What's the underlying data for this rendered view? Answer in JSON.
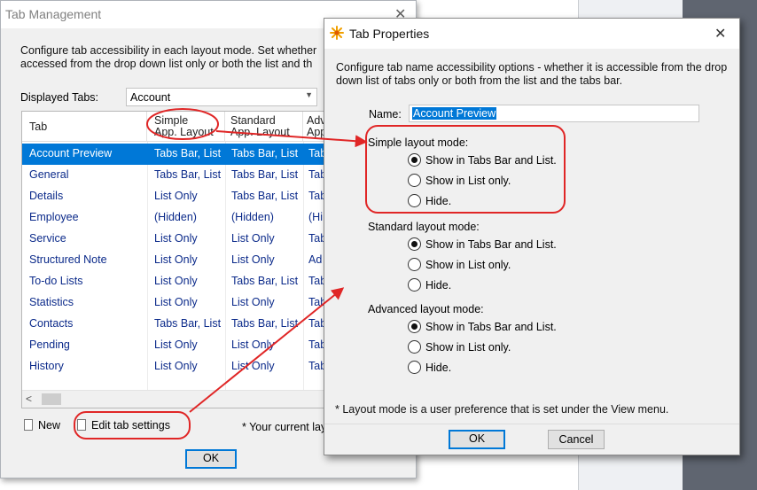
{
  "tab_management": {
    "title": "Tab Management",
    "description_line1": "Configure tab accessibility in each layout mode. Set whether",
    "description_line2": "accessed from the drop down list only or both the list and th",
    "displayed_tabs_label": "Displayed Tabs:",
    "displayed_tabs_value": "Account",
    "columns": [
      {
        "line1": "Tab",
        "line2": ""
      },
      {
        "line1": "Simple",
        "line2": "App. Layout"
      },
      {
        "line1": "Standard",
        "line2": "App. Layout"
      },
      {
        "line1": "Adv",
        "line2": "App"
      }
    ],
    "rows": [
      {
        "name": "Account Preview",
        "simple": "Tabs Bar, List",
        "standard": "Tabs Bar, List",
        "adv": "Tab"
      },
      {
        "name": "General",
        "simple": "Tabs Bar, List",
        "standard": "Tabs Bar, List",
        "adv": "Tab"
      },
      {
        "name": "Details",
        "simple": "List Only",
        "standard": "Tabs Bar, List",
        "adv": "Tab"
      },
      {
        "name": "Employee",
        "simple": "(Hidden)",
        "standard": "(Hidden)",
        "adv": "(Hi"
      },
      {
        "name": "Service",
        "simple": "List Only",
        "standard": "List Only",
        "adv": "Tab"
      },
      {
        "name": "Structured Note",
        "simple": "List Only",
        "standard": "List Only",
        "adv": "Ad"
      },
      {
        "name": "To-do Lists",
        "simple": "List Only",
        "standard": "Tabs Bar, List",
        "adv": "Tab"
      },
      {
        "name": "Statistics",
        "simple": "List Only",
        "standard": "List Only",
        "adv": "Tab"
      },
      {
        "name": "Contacts",
        "simple": "Tabs Bar, List",
        "standard": "Tabs Bar, List",
        "adv": "Tab"
      },
      {
        "name": "Pending",
        "simple": "List Only",
        "standard": "List Only",
        "adv": "Tab"
      },
      {
        "name": "History",
        "simple": "List Only",
        "standard": "List Only",
        "adv": "Tab"
      }
    ],
    "new_label": "New",
    "edit_label": "Edit tab settings",
    "current_note": "* Your current lay",
    "ok_label": "OK"
  },
  "tab_properties": {
    "title": "Tab Properties",
    "description": "Configure tab name accessibility options - whether it is accessible from the drop down list of tabs only or both from the list and the tabs bar.",
    "name_label": "Name:",
    "name_value": "Account Preview",
    "groups": [
      {
        "label": "Simple layout mode:",
        "options": [
          "Show in Tabs Bar and List.",
          "Show in List only.",
          "Hide."
        ],
        "selected": 0
      },
      {
        "label": "Standard layout mode:",
        "options": [
          "Show in Tabs Bar and List.",
          "Show in List only.",
          "Hide."
        ],
        "selected": 0
      },
      {
        "label": "Advanced layout mode:",
        "options": [
          "Show in Tabs Bar and List.",
          "Show in List only.",
          "Hide."
        ],
        "selected": 0
      }
    ],
    "footnote": "* Layout mode is a user preference that is set under the View menu.",
    "ok_label": "OK",
    "cancel_label": "Cancel"
  },
  "colors": {
    "accent": "#0078d7",
    "annotation": "#e02626",
    "link_text": "#0b2a8a"
  }
}
